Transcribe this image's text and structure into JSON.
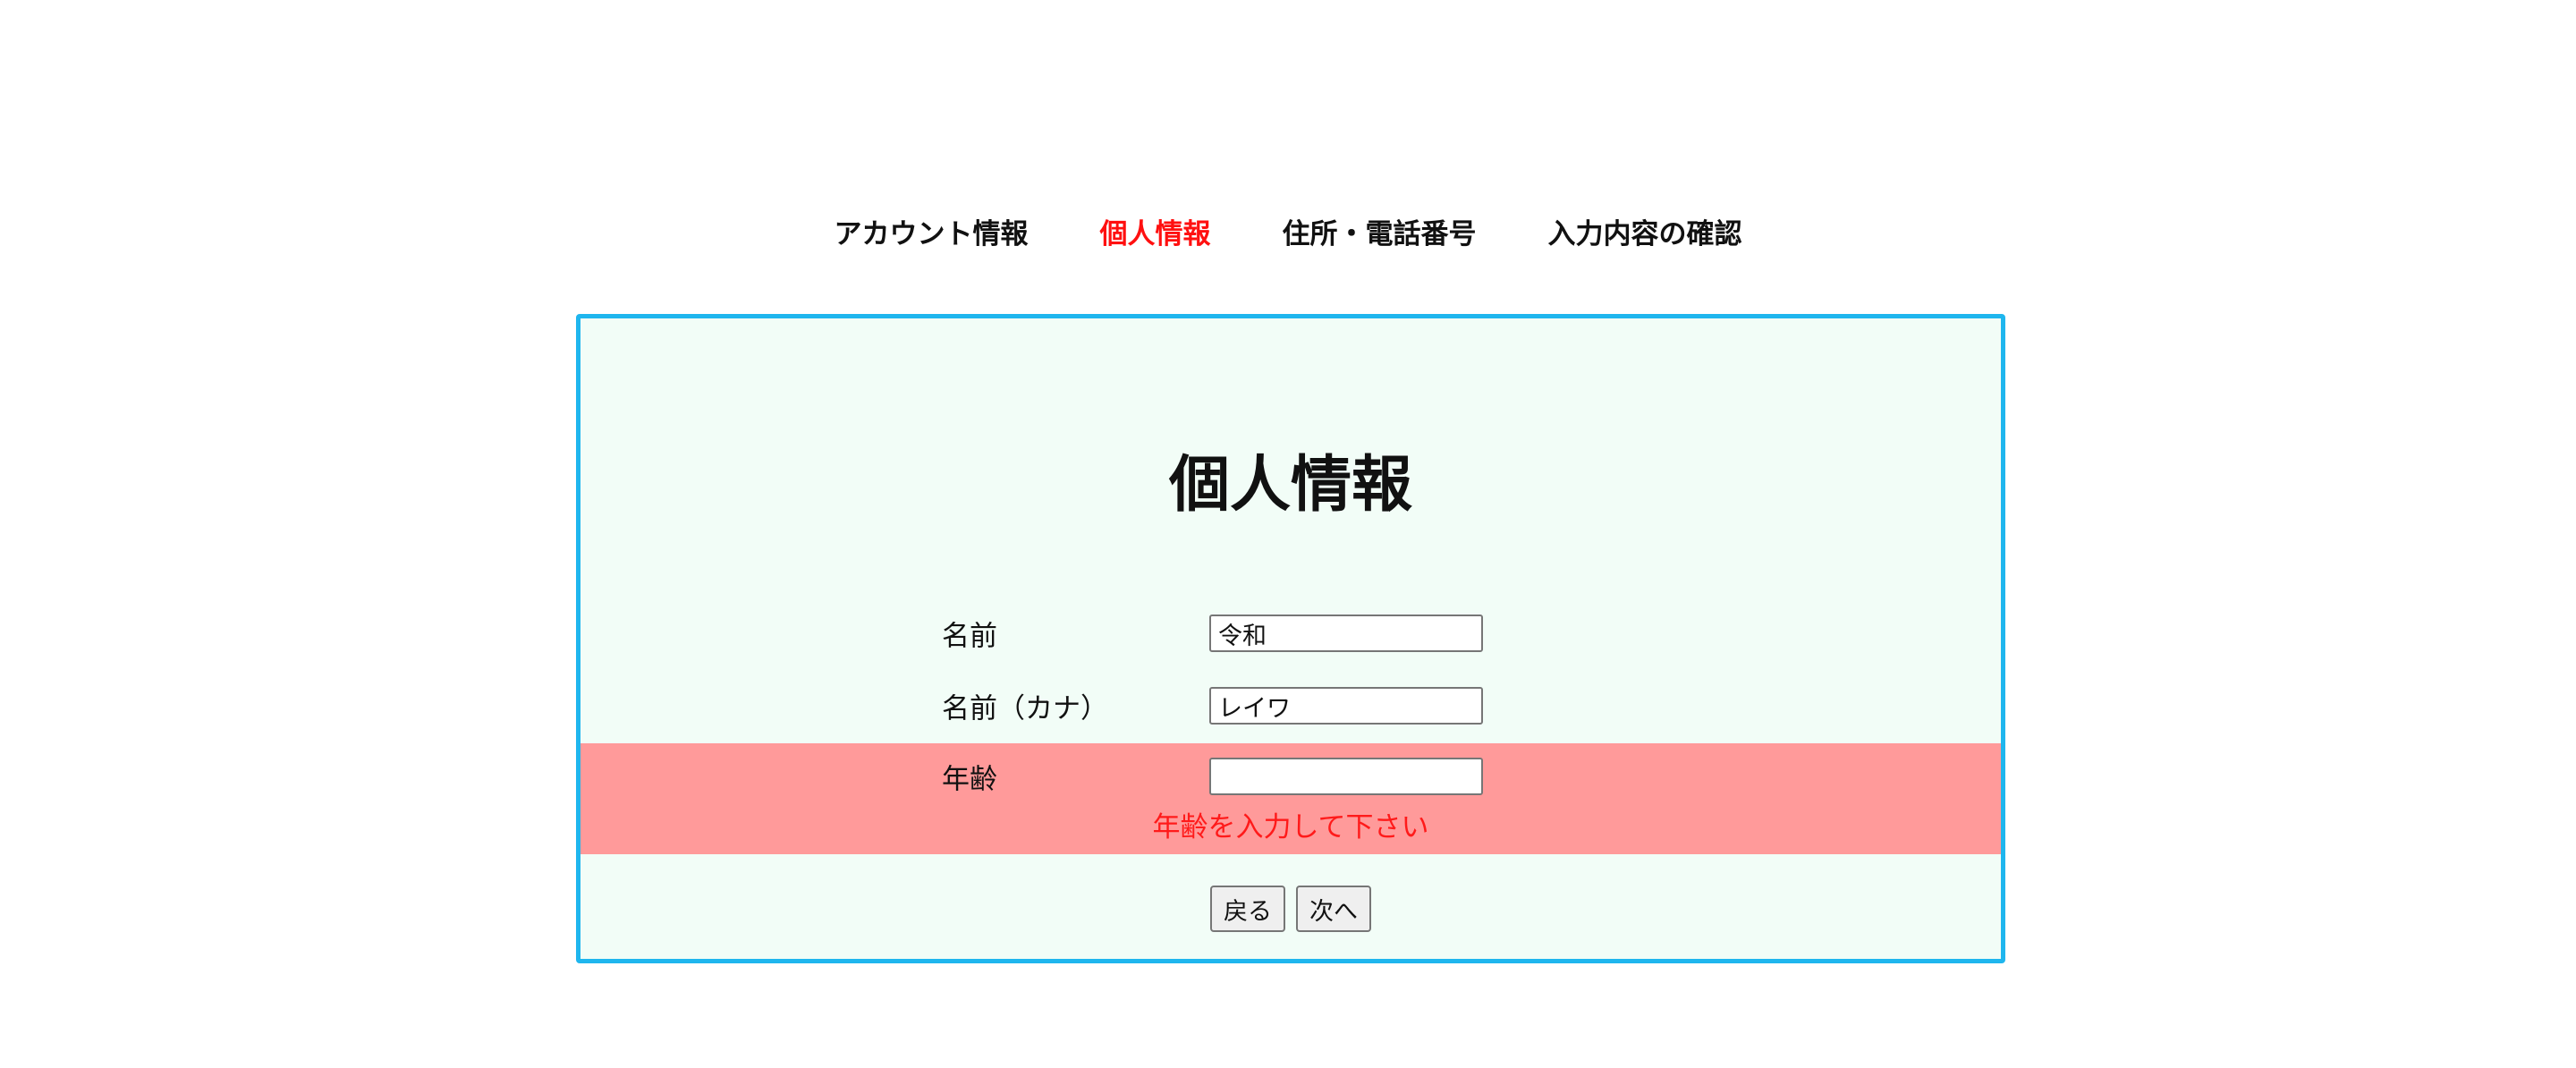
{
  "steps": [
    {
      "label": "アカウント情報",
      "active": false
    },
    {
      "label": "個人情報",
      "active": true
    },
    {
      "label": "住所・電話番号",
      "active": false
    },
    {
      "label": "入力内容の確認",
      "active": false
    }
  ],
  "colors": {
    "active_step": "#ff1010",
    "panel_border": "#1fb6ee",
    "panel_bg": "#f2fdf7",
    "error_band": "#ff9a9a",
    "error_text": "#ff1a1a"
  },
  "form": {
    "title": "個人情報",
    "name": {
      "label": "名前",
      "value": "令和"
    },
    "kana": {
      "label": "名前（カナ）",
      "value": "レイワ"
    },
    "age": {
      "label": "年齢",
      "value": ""
    },
    "error": "年齢を入力して下さい"
  },
  "buttons": {
    "back": "戻る",
    "next": "次へ"
  }
}
